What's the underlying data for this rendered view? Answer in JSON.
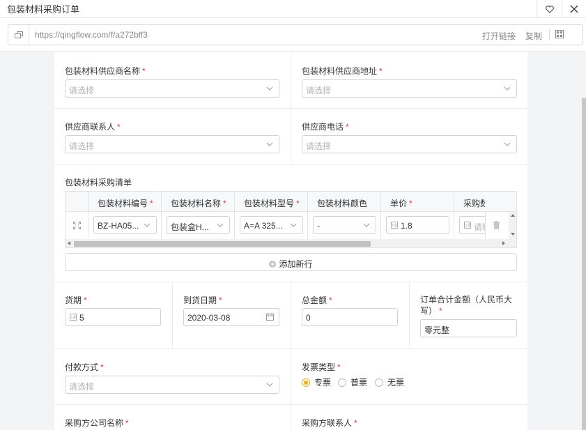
{
  "window": {
    "title": "包装材料采购订单"
  },
  "url_bar": {
    "url": "https://qingflow.com/f/a272bff3",
    "open_link": "打开链接",
    "copy": "复制"
  },
  "form": {
    "supplier_name": {
      "label": "包装材料供应商名称",
      "required": "*",
      "placeholder": "请选择"
    },
    "supplier_address": {
      "label": "包装材料供应商地址",
      "required": "*",
      "placeholder": "请选择"
    },
    "supplier_contact": {
      "label": "供应商联系人",
      "required": "*",
      "placeholder": "请选择"
    },
    "supplier_phone": {
      "label": "供应商电话",
      "required": "*",
      "placeholder": "请选择"
    },
    "purchase_list": {
      "label": "包装材料采购清单",
      "columns": [
        {
          "label": "包装材料编号",
          "required": "*"
        },
        {
          "label": "包装材料名称",
          "required": "*"
        },
        {
          "label": "包装材料型号",
          "required": "*"
        },
        {
          "label": "包装材料颜色",
          "required": ""
        },
        {
          "label": "单价",
          "required": "*"
        },
        {
          "label": "采购数",
          "required": ""
        }
      ],
      "rows": [
        {
          "code": "BZ-HA05...",
          "name": "包装盒H...",
          "model": "A=A 325...",
          "color": "-",
          "price": "1.8",
          "qty_placeholder": "请输"
        }
      ],
      "add_row": "添加新行"
    },
    "lead_time": {
      "label": "货期",
      "required": "*",
      "value": "5"
    },
    "arrival_date": {
      "label": "到货日期",
      "required": "*",
      "value": "2020-03-08"
    },
    "total_amount": {
      "label": "总金额",
      "required": "*",
      "value": "0"
    },
    "total_rmb": {
      "label_line1": "订单合计金额（人民币大",
      "label_line2": "写）",
      "required": "*",
      "value": "零元整"
    },
    "payment_method": {
      "label": "付款方式",
      "required": "*",
      "placeholder": "请选择"
    },
    "invoice_type": {
      "label": "发票类型",
      "required": "*",
      "options": [
        "专票",
        "普票",
        "无票"
      ],
      "selected": "专票"
    },
    "buyer_company": {
      "label": "采购方公司名称",
      "required": "*"
    },
    "buyer_contact": {
      "label": "采购方联系人",
      "required": "*"
    }
  },
  "colors": {
    "required": "#e5373c",
    "radio_selected": "#f2a91a"
  }
}
